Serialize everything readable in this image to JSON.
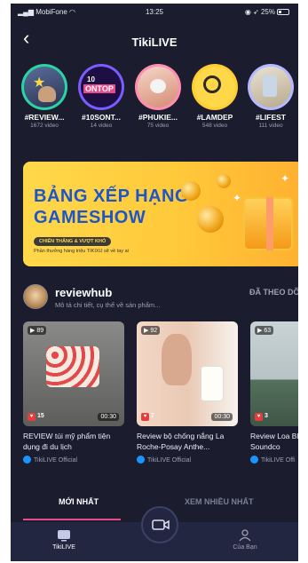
{
  "status_bar": {
    "carrier": "MobiFone",
    "time": "13:25",
    "battery": "25%"
  },
  "header": {
    "title": "TikiLIVE"
  },
  "topics": [
    {
      "tag": "#REVIEW...",
      "count": "1672 video",
      "color": "#2bd3a7"
    },
    {
      "tag": "#10SONT...",
      "count": "14 video",
      "color": "#7b5cff"
    },
    {
      "tag": "#PHUKIE...",
      "count": "75 video",
      "color": "#ff8fb1"
    },
    {
      "tag": "#LAMDEP",
      "count": "548 video",
      "color": "#ffcc33"
    },
    {
      "tag": "#LIFEST",
      "count": "111 video",
      "color": "#b5b9ff"
    }
  ],
  "topic_badge_text": {
    "line1": "10",
    "line2": "ONTOP"
  },
  "banner": {
    "line1": "BẢNG XẾP HẠNG",
    "line2": "GAMESHOW",
    "pill": "CHIẾN THẮNG & VƯỢT KHÓ",
    "sub": "Phần thưởng hàng triệu TIKIXU sẽ về tay ai"
  },
  "channel": {
    "name": "reviewhub",
    "description": "Mô tả chi tiết, cụ thể về sản phẩm...",
    "follow_label": "ĐÃ THEO DÕI"
  },
  "videos": [
    {
      "views": "89",
      "likes": "15",
      "duration": "00:30",
      "title": "REVIEW túi mỹ phẩm tiện dụng đi du lịch",
      "author": "TikiLIVE Official"
    },
    {
      "views": "92",
      "likes": "7",
      "duration": "00:30",
      "title": "Review bộ chống nắng La Roche-Posay Anthe...",
      "author": "TikiLIVE Official"
    },
    {
      "views": "63",
      "likes": "3",
      "duration": "",
      "title": "Review Loa Blu Anker Soundco",
      "author": "TikiLIVE Offi"
    }
  ],
  "tabs": {
    "newest": "MỚI NHẤT",
    "most_viewed": "XEM NHIỀU NHẤT"
  },
  "nav": {
    "home": "TikiLIVE",
    "user": "Của Bạn"
  }
}
